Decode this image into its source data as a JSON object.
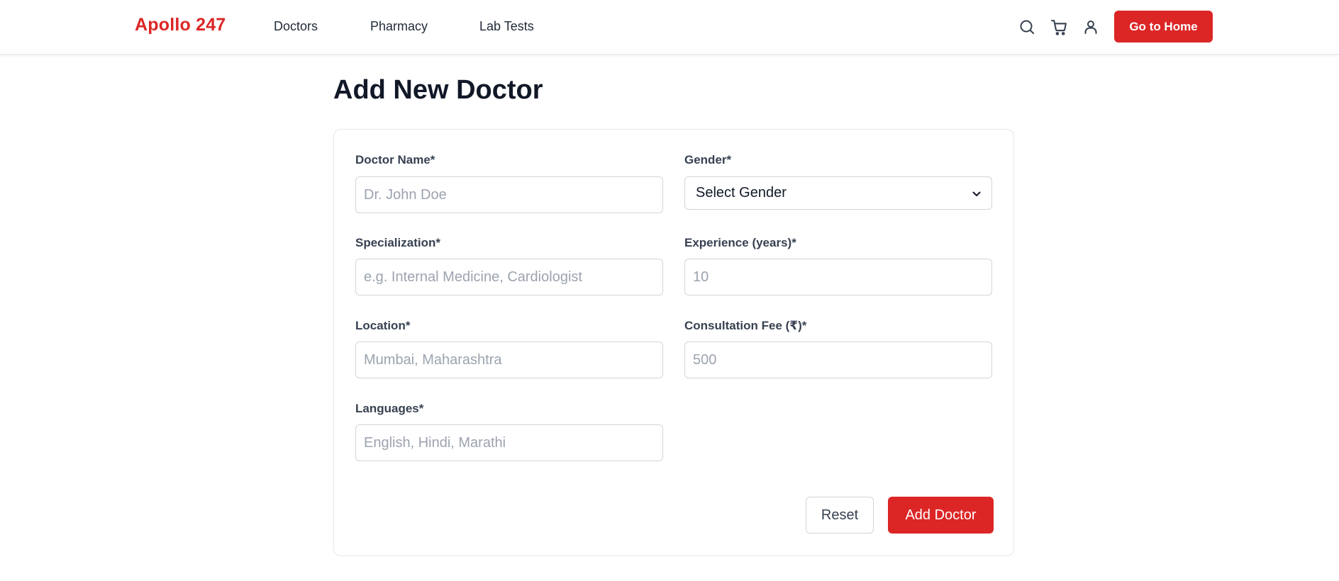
{
  "header": {
    "brand": "Apollo 247",
    "nav": [
      "Doctors",
      "Pharmacy",
      "Lab Tests"
    ],
    "icons": [
      "search-icon",
      "cart-icon",
      "user-icon"
    ],
    "home_button": "Go to Home"
  },
  "page": {
    "title": "Add New Doctor"
  },
  "form": {
    "doctor_name": {
      "label": "Doctor Name*",
      "placeholder": "Dr. John Doe",
      "value": ""
    },
    "gender": {
      "label": "Gender*",
      "selected": "Select Gender"
    },
    "specialization": {
      "label": "Specialization*",
      "placeholder": "e.g. Internal Medicine, Cardiologist",
      "value": ""
    },
    "experience": {
      "label": "Experience (years)*",
      "placeholder": "10",
      "value": ""
    },
    "location": {
      "label": "Location*",
      "placeholder": "Mumbai, Maharashtra",
      "value": ""
    },
    "fee": {
      "label": "Consultation Fee (₹)*",
      "placeholder": "500",
      "value": ""
    },
    "languages": {
      "label": "Languages*",
      "placeholder": "English, Hindi, Marathi",
      "value": ""
    },
    "reset_button": "Reset",
    "submit_button": "Add Doctor"
  },
  "colors": {
    "accent": "#dc2626",
    "text": "#111827",
    "border": "#d1d5db",
    "placeholder": "#9ca3af"
  }
}
